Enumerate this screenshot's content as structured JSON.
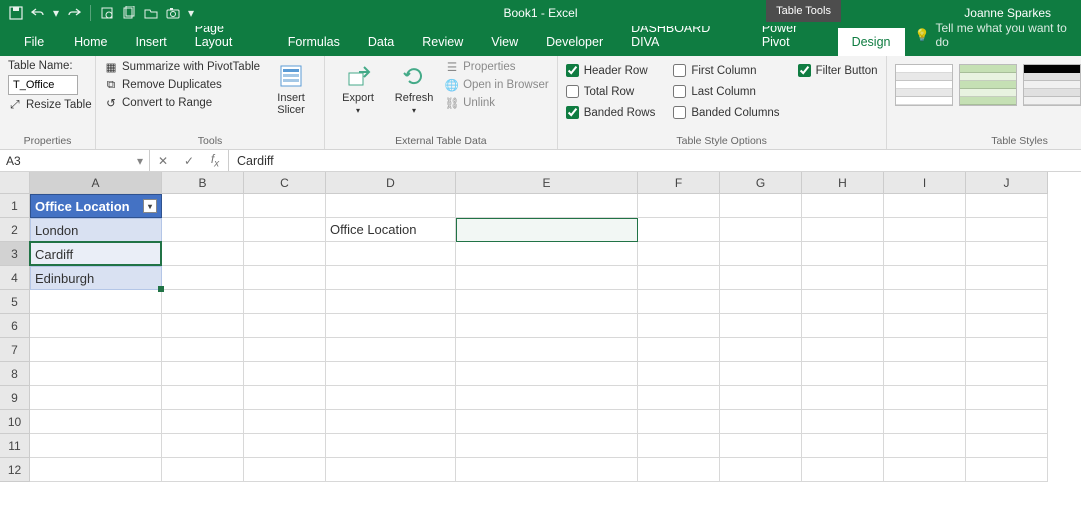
{
  "titlebar": {
    "app_title": "Book1  -  Excel",
    "table_tools": "Table Tools",
    "username": "Joanne Sparkes"
  },
  "tabs": {
    "file": "File",
    "items": [
      "Home",
      "Insert",
      "Page Layout",
      "Formulas",
      "Data",
      "Review",
      "View",
      "Developer",
      "DASHBOARD DIVA",
      "Power Pivot",
      "Design"
    ],
    "active": "Design",
    "tell_me": "Tell me what you want to do"
  },
  "ribbon": {
    "properties": {
      "table_name_label": "Table Name:",
      "table_name_value": "T_Office",
      "resize": "Resize Table",
      "label": "Properties"
    },
    "tools": {
      "summarize": "Summarize with PivotTable",
      "remove_dupes": "Remove Duplicates",
      "convert": "Convert to Range",
      "insert_slicer": "Insert Slicer",
      "label": "Tools"
    },
    "external": {
      "export": "Export",
      "refresh": "Refresh",
      "properties": "Properties",
      "open_browser": "Open in Browser",
      "unlink": "Unlink",
      "label": "External Table Data"
    },
    "options": {
      "header_row": "Header Row",
      "total_row": "Total Row",
      "banded_rows": "Banded Rows",
      "first_col": "First Column",
      "last_col": "Last Column",
      "banded_cols": "Banded Columns",
      "filter_btn": "Filter Button",
      "label": "Table Style Options",
      "checked": {
        "header_row": true,
        "total_row": false,
        "banded_rows": true,
        "first_col": false,
        "last_col": false,
        "banded_cols": false,
        "filter_btn": true
      }
    },
    "styles": {
      "label": "Table Styles"
    }
  },
  "formula_bar": {
    "name_box": "A3",
    "formula": "Cardiff"
  },
  "grid": {
    "col_widths": {
      "A": 132,
      "default": 82,
      "D": 130,
      "E": 182
    },
    "columns": [
      "A",
      "B",
      "C",
      "D",
      "E",
      "F",
      "G",
      "H",
      "I",
      "J"
    ],
    "rows": 12,
    "active_cell": "A3",
    "selected_range": "E2",
    "table_header": "Office Location",
    "table_rows": [
      "London",
      "Cardiff",
      "Edinburgh"
    ],
    "d2": "Office Location"
  }
}
